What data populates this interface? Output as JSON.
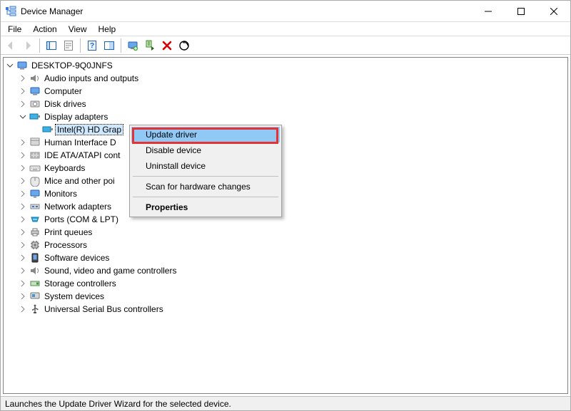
{
  "window": {
    "title": "Device Manager"
  },
  "menubar": {
    "file": "File",
    "action": "Action",
    "view": "View",
    "help": "Help"
  },
  "tree": {
    "root": "DESKTOP-9Q0JNFS",
    "nodes": {
      "audio": "Audio inputs and outputs",
      "computer": "Computer",
      "disk": "Disk drives",
      "display": "Display adapters",
      "intelhd": "Intel(R) HD Grap",
      "hid": "Human Interface D",
      "ide": "IDE ATA/ATAPI cont",
      "keyboards": "Keyboards",
      "mice": "Mice and other poi",
      "monitors": "Monitors",
      "network": "Network adapters",
      "ports": "Ports (COM & LPT)",
      "printq": "Print queues",
      "processors": "Processors",
      "softdev": "Software devices",
      "soundvideo": "Sound, video and game controllers",
      "storagectrl": "Storage controllers",
      "sysdev": "System devices",
      "usb": "Universal Serial Bus controllers"
    }
  },
  "context_menu": {
    "update": "Update driver",
    "disable": "Disable device",
    "uninstall": "Uninstall device",
    "scan": "Scan for hardware changes",
    "properties": "Properties"
  },
  "statusbar": {
    "text": "Launches the Update Driver Wizard for the selected device."
  }
}
